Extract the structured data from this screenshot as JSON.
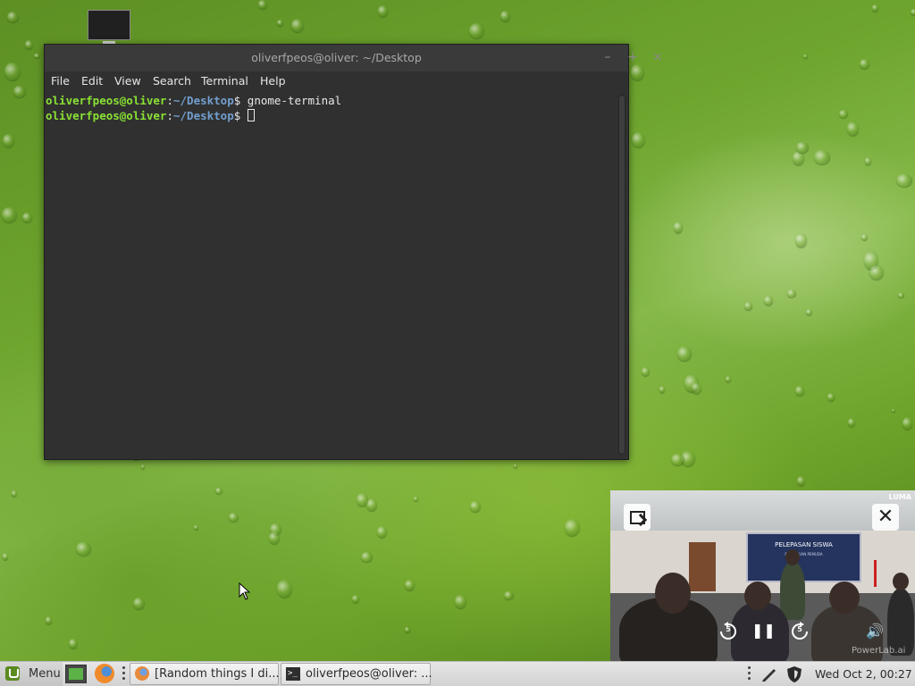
{
  "terminal": {
    "title": "oliverfpeos@oliver: ~/Desktop",
    "buttons": {
      "minimize": "–",
      "maximize": "+",
      "close": "×"
    },
    "menu": [
      "File",
      "Edit",
      "View",
      "Search",
      "Terminal",
      "Help"
    ],
    "lines": [
      {
        "user": "oliverfpeos@oliver",
        "sep": ":",
        "path": "~/Desktop",
        "prompt": "$ ",
        "cmd": "gnome-terminal"
      },
      {
        "user": "oliverfpeos@oliver",
        "sep": ":",
        "path": "~/Desktop",
        "prompt": "$ ",
        "cmd": ""
      }
    ]
  },
  "video": {
    "banner_title": "PELEPASAN SISWA",
    "banner_sub": "PERSATUAN PEMUDA",
    "watermark_top": "LUMA",
    "watermark_bottom": "PowerLab.ai",
    "close_glyph": "✕",
    "controls": {
      "rewind_seconds": "5",
      "forward_seconds": "5",
      "pause": "❚❚",
      "volume": "🔊"
    }
  },
  "taskbar": {
    "menu_label": "Menu",
    "tasks": [
      {
        "label": "[Random things I di..."
      },
      {
        "label": "oliverfpeos@oliver: ..."
      }
    ],
    "clock": "Wed Oct  2, 00:27",
    "icons": {
      "menu": "mint-logo-icon",
      "launcher_terminal": "terminal-icon",
      "launcher_browser": "firefox-icon",
      "task1": "firefox-icon",
      "task2": "terminal-icon",
      "tray_pen": "pen-icon",
      "tray_shield": "shield-icon"
    }
  },
  "colors": {
    "terminal_bg": "#303030",
    "prompt_user": "#8ae234",
    "prompt_path": "#729fcf",
    "desktop_green": "#6ea52e"
  }
}
